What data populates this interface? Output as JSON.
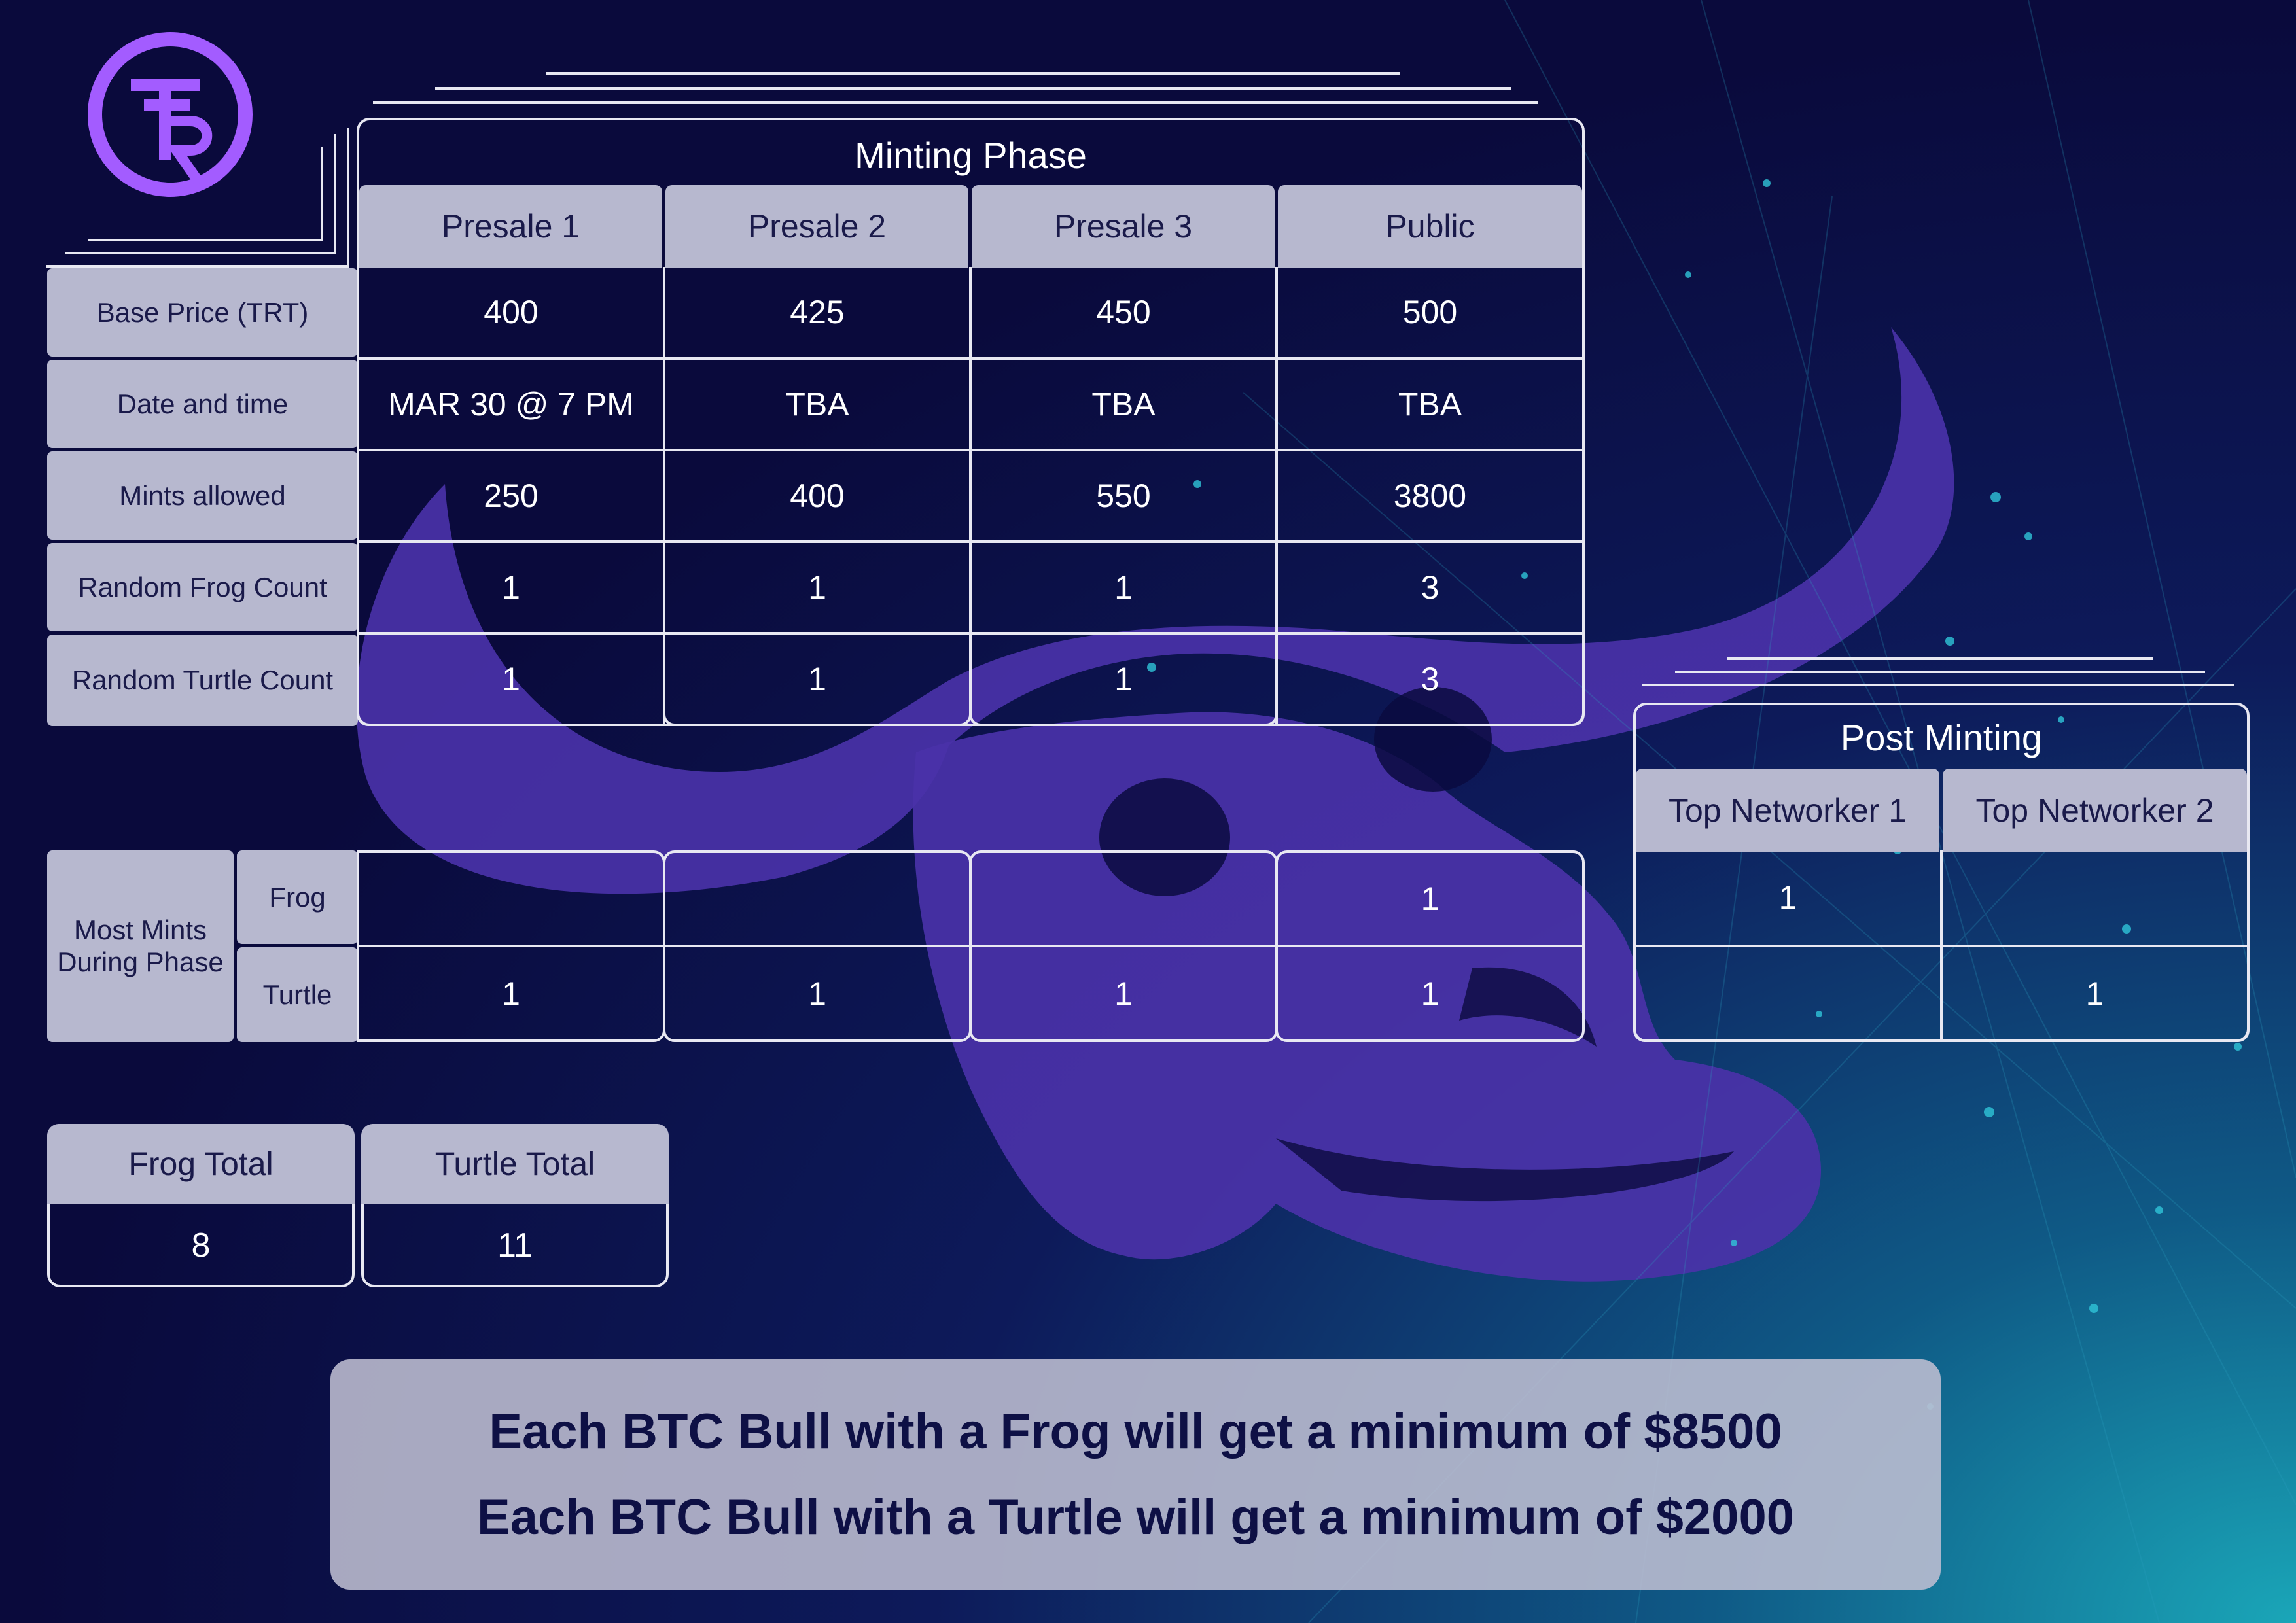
{
  "logo": {
    "text": "TR",
    "color": "#a35cff"
  },
  "minting": {
    "title": "Minting Phase",
    "phases": [
      "Presale 1",
      "Presale 2",
      "Presale 3",
      "Public"
    ],
    "rows": [
      {
        "label": "Base Price (TRT)",
        "values": [
          "400",
          "425",
          "450",
          "500"
        ]
      },
      {
        "label": "Date and time",
        "values": [
          "MAR 30 @ 7 PM",
          "TBA",
          "TBA",
          "TBA"
        ]
      },
      {
        "label": "Mints allowed",
        "values": [
          "250",
          "400",
          "550",
          "3800"
        ]
      },
      {
        "label": "Random Frog Count",
        "values": [
          "1",
          "1",
          "1",
          "3"
        ]
      },
      {
        "label": "Random Turtle Count",
        "values": [
          "1",
          "1",
          "1",
          "3"
        ]
      }
    ]
  },
  "most_mints": {
    "label": "Most Mints During Phase",
    "frog_label": "Frog",
    "turtle_label": "Turtle",
    "frog_values": [
      "",
      "",
      "",
      "1"
    ],
    "turtle_values": [
      "1",
      "1",
      "1",
      "1"
    ]
  },
  "post_minting": {
    "title": "Post Minting",
    "columns": [
      "Top Networker 1",
      "Top Networker 2"
    ],
    "frog_values": [
      "1",
      ""
    ],
    "turtle_values": [
      "",
      "1"
    ]
  },
  "totals": {
    "frog_label": "Frog Total",
    "frog_value": "8",
    "turtle_label": "Turtle Total",
    "turtle_value": "11"
  },
  "banner": {
    "line1": "Each BTC Bull with a Frog will get a minimum of $8500",
    "line2": "Each BTC Bull with a Turtle will get a minimum of $2000"
  },
  "colors": {
    "background": "#0b0b3f",
    "header_fill": "#b7b8cf",
    "bull": "#4a32a8",
    "accent": "#1aa6b8"
  }
}
